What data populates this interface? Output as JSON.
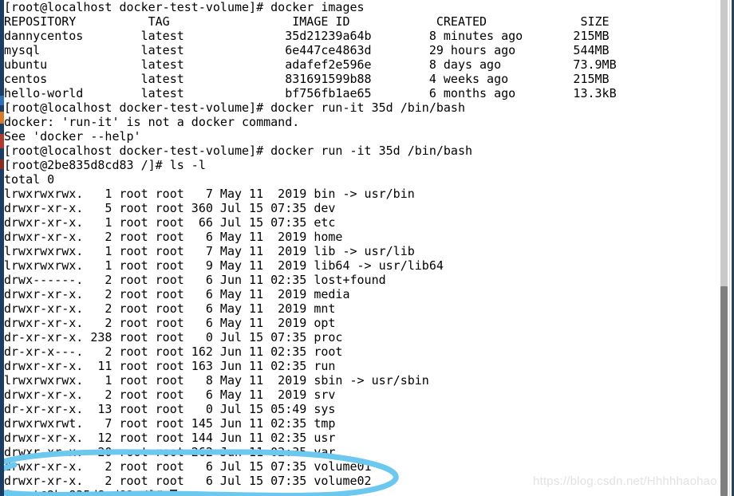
{
  "terminal": {
    "lines": [
      "[root@localhost docker-test-volume]# docker images",
      "REPOSITORY          TAG                 IMAGE ID            CREATED             SIZE",
      "dannycentos        latest              35d21239a64b        8 minutes ago       215MB",
      "mysql              latest              6e447ce4863d        29 hours ago        544MB",
      "ubuntu             latest              adafef2e596e        8 days ago          73.9MB",
      "centos             latest              831691599b88        4 weeks ago         215MB",
      "hello-world        latest              bf756fb1ae65        6 months ago        13.3kB",
      "[root@localhost docker-test-volume]# docker run-it 35d /bin/bash",
      "docker: 'run-it' is not a docker command.",
      "See 'docker --help'",
      "[root@localhost docker-test-volume]# docker run -it 35d /bin/bash",
      "[root@2be835d8cd83 /]# ls -l",
      "total 0",
      "lrwxrwxrwx.   1 root root   7 May 11  2019 bin -> usr/bin",
      "drwxr-xr-x.   5 root root 360 Jul 15 07:35 dev",
      "drwxr-xr-x.   1 root root  66 Jul 15 07:35 etc",
      "drwxr-xr-x.   2 root root   6 May 11  2019 home",
      "lrwxrwxrwx.   1 root root   7 May 11  2019 lib -> usr/lib",
      "lrwxrwxrwx.   1 root root   9 May 11  2019 lib64 -> usr/lib64",
      "drwx------.   2 root root   6 Jun 11 02:35 lost+found",
      "drwxr-xr-x.   2 root root   6 May 11  2019 media",
      "drwxr-xr-x.   2 root root   6 May 11  2019 mnt",
      "drwxr-xr-x.   2 root root   6 May 11  2019 opt",
      "dr-xr-xr-x. 238 root root   0 Jul 15 07:35 proc",
      "dr-xr-x---.   2 root root 162 Jun 11 02:35 root",
      "drwxr-xr-x.  11 root root 163 Jun 11 02:35 run",
      "lrwxrwxrwx.   1 root root   8 May 11  2019 sbin -> usr/sbin",
      "drwxr-xr-x.   2 root root   6 May 11  2019 srv",
      "dr-xr-xr-x.  13 root root   0 Jul 15 05:49 sys",
      "drwxrwxrwt.   7 root root 145 Jun 11 02:35 tmp",
      "drwxr-xr-x.  12 root root 144 Jun 11 02:35 usr",
      "drwxr-xr-x.  20 root root 262 Jun 11 02:35 var",
      "drwxr-xr-x.   2 root root   6 Jul 15 07:35 volume01",
      "drwxr-xr-x.   2 root root   6 Jul 15 07:35 volume02"
    ],
    "prompt_line": "[root@2be835d8cd83 /]# ",
    "images_table": {
      "headers": [
        "REPOSITORY",
        "TAG",
        "IMAGE ID",
        "CREATED",
        "SIZE"
      ],
      "rows": [
        [
          "dannycentos",
          "latest",
          "35d21239a64b",
          "8 minutes ago",
          "215MB"
        ],
        [
          "mysql",
          "latest",
          "6e447ce4863d",
          "29 hours ago",
          "544MB"
        ],
        [
          "ubuntu",
          "latest",
          "adafef2e596e",
          "8 days ago",
          "73.9MB"
        ],
        [
          "centos",
          "latest",
          "831691599b88",
          "4 weeks ago",
          "215MB"
        ],
        [
          "hello-world",
          "latest",
          "bf756fb1ae65",
          "6 months ago",
          "13.3kB"
        ]
      ]
    },
    "commands": [
      "docker images",
      "docker run-it 35d /bin/bash",
      "docker run -it 35d /bin/bash",
      "ls -l"
    ],
    "error_message": "docker: 'run-it' is not a docker command.",
    "help_hint": "See 'docker --help'",
    "total_line": "total 0",
    "colors": {
      "text": "#000000",
      "background": "#ffffff",
      "annotation_blue": "#6dc8f0",
      "scrollbar_thumb": "#7f7f7f",
      "scrollbar_track": "#c9c9c9"
    }
  },
  "annotation": {
    "label": "highlight-circle-volumes",
    "color": "#6dc8f0"
  },
  "watermark": {
    "text": "https://blog.csdn.net/Hhhhhaohao"
  }
}
